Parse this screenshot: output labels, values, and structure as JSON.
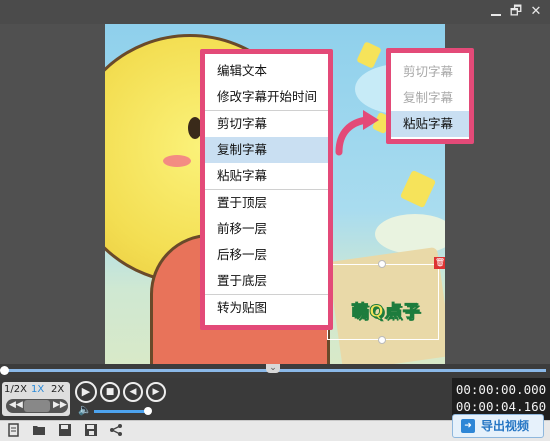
{
  "window": {
    "restore_glyph": "🗗",
    "close_glyph": "✕"
  },
  "video": {
    "overlay_text": "萌Q点子"
  },
  "context_menu": {
    "items": [
      "编辑文本",
      "修改字幕开始时间",
      "剪切字幕",
      "复制字幕",
      "粘贴字幕",
      "置于顶层",
      "前移一层",
      "后移一层",
      "置于底层",
      "转为贴图"
    ],
    "highlighted": "复制字幕"
  },
  "secondary_menu": {
    "items": [
      "剪切字幕",
      "复制字幕",
      "粘贴字幕"
    ],
    "disabled": [
      "剪切字幕",
      "复制字幕"
    ],
    "highlighted": "粘贴字幕"
  },
  "playback": {
    "speeds": [
      "1/2X",
      "1X",
      "2X"
    ],
    "selected_speed": "1X",
    "volume_level": 0.8,
    "current_time": "00:00:00.000",
    "total_time": "00:00:04.160"
  },
  "toolbar": {
    "icons": [
      "new-project-icon",
      "open-folder-icon",
      "save-icon",
      "save-as-icon",
      "share-icon"
    ],
    "export_label": "导出视频"
  },
  "colors": {
    "menu_border": "#e34a78",
    "highlight": "#c9dff2",
    "accent": "#2676c4"
  }
}
